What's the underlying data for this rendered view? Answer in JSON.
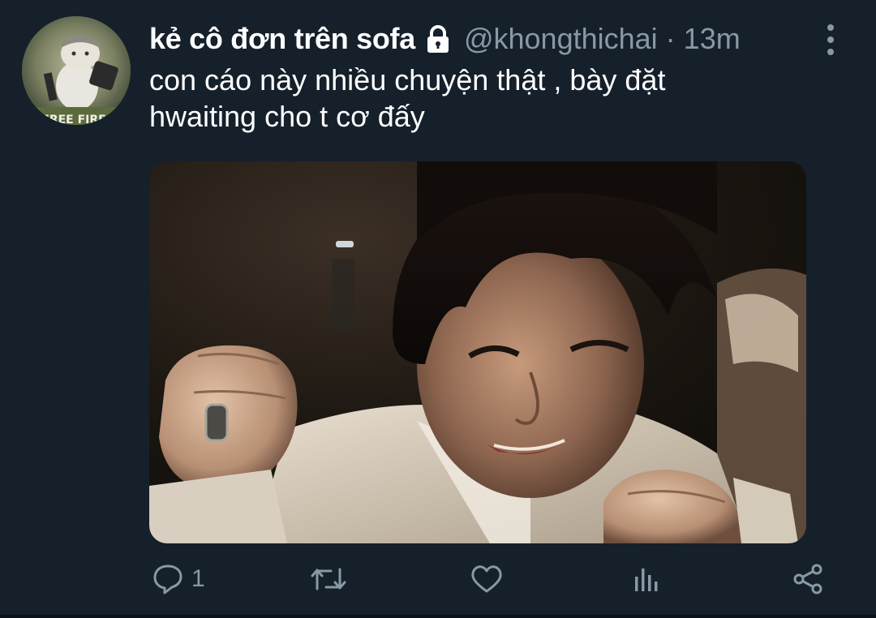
{
  "author": {
    "display_name": "kẻ cô đơn trên sofa",
    "handle": "@khongthichai",
    "separator": "·",
    "time": "13m",
    "protected_icon": "lock-icon",
    "avatar_logo_text": "FREE FIRE"
  },
  "tweet": {
    "text_lines": [
      "con cáo này nhiều chuyện thật , bày đặt",
      "hwaiting cho t cơ đấy"
    ]
  },
  "actions": {
    "reply_icon": "reply-icon",
    "reply_count": "1",
    "retweet_icon": "retweet-icon",
    "like_icon": "heart-icon",
    "stats_icon": "analytics-icon",
    "share_icon": "share-icon"
  },
  "colors": {
    "background": "#15202b",
    "text_primary": "#ffffff",
    "text_secondary": "#8899a6"
  }
}
